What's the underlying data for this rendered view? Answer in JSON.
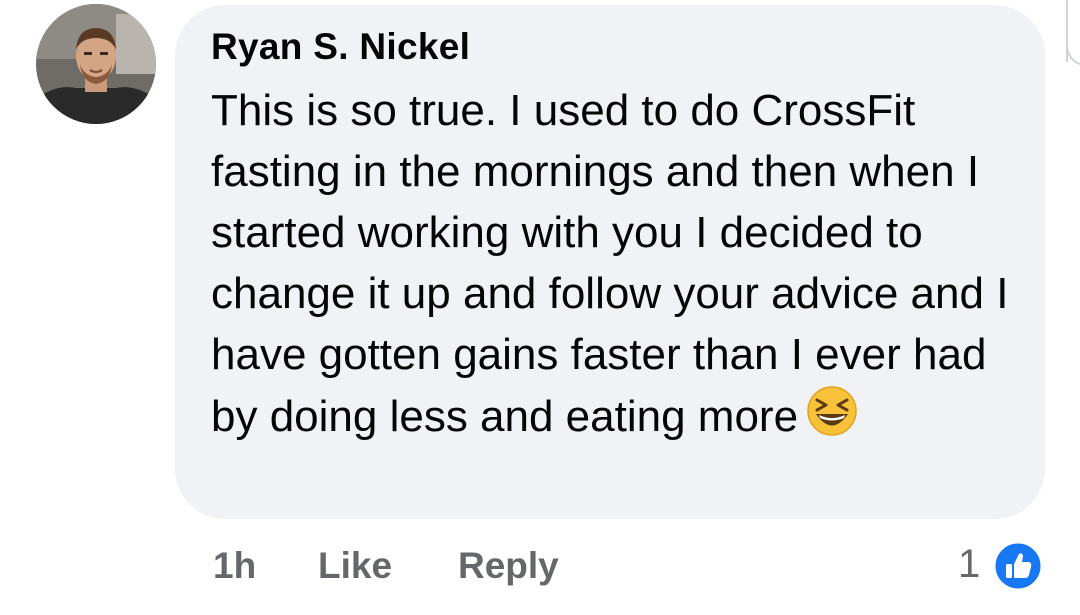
{
  "comment": {
    "author": "Ryan S. Nickel",
    "text": "This is so true. I used to do CrossFit fasting in the mornings and then when I started working with you I decided to change it up and follow your advice and I have gotten gains faster than I ever had by doing less and eating more",
    "emoji_icon": "grinning-squinting-face-icon"
  },
  "actions": {
    "time": "1h",
    "like_label": "Like",
    "reply_label": "Reply"
  },
  "reactions": {
    "count": "1",
    "icon": "like-reaction-icon",
    "badge_color": "#1877f2"
  },
  "colors": {
    "bubble": "#f0f2f5",
    "text": "#050505",
    "secondary": "#65676b"
  }
}
